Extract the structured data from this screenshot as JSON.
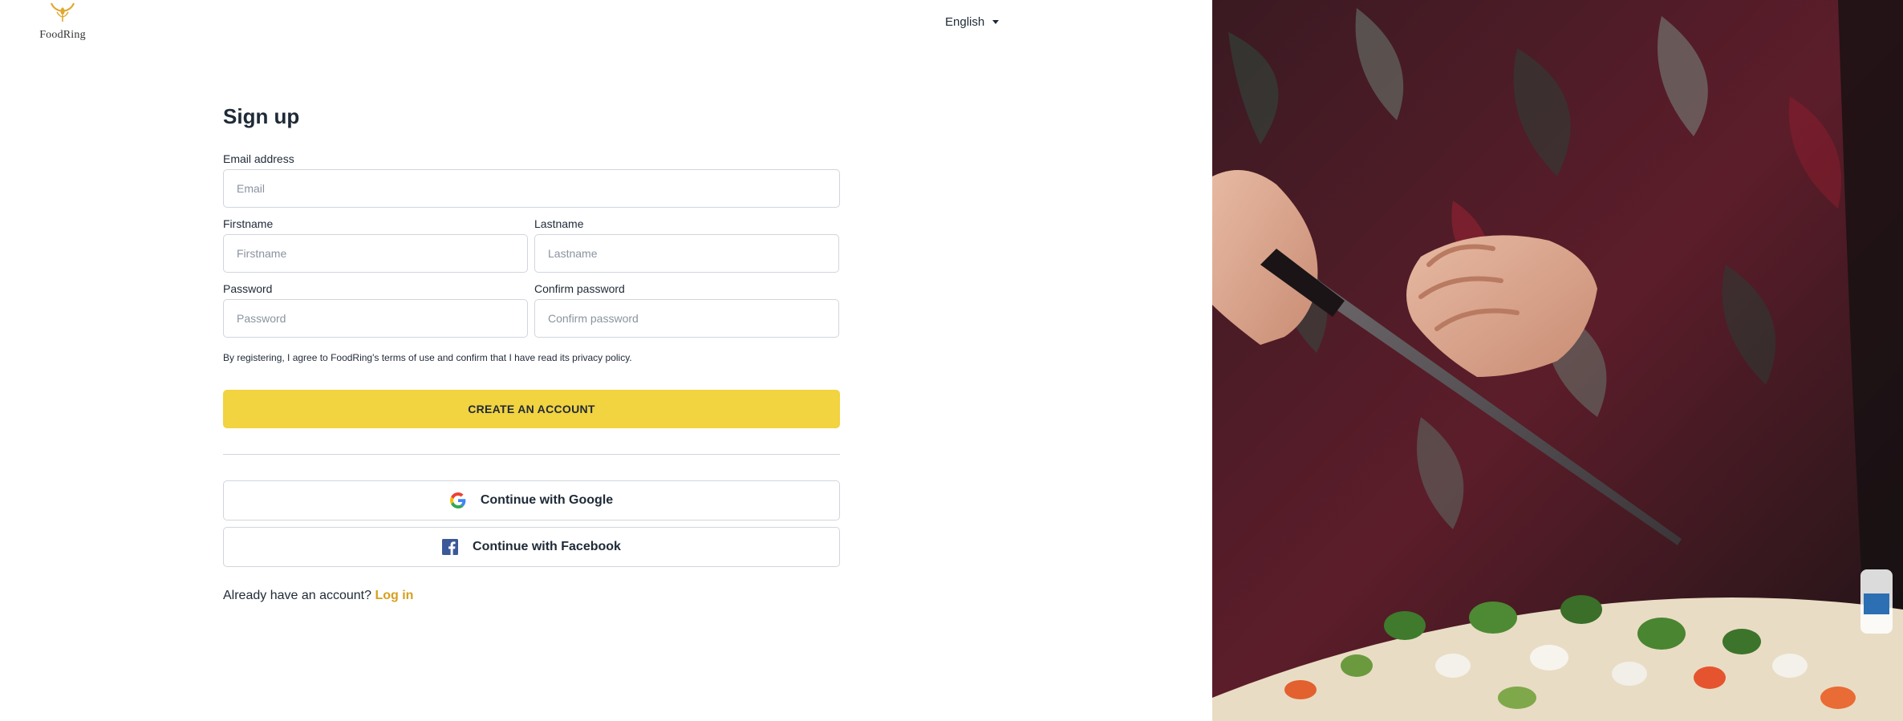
{
  "brand": {
    "name": "FoodRing"
  },
  "header": {
    "language": "English"
  },
  "form": {
    "title": "Sign up",
    "email": {
      "label": "Email address",
      "placeholder": "Email"
    },
    "firstname": {
      "label": "Firstname",
      "placeholder": "Firstname"
    },
    "lastname": {
      "label": "Lastname",
      "placeholder": "Lastname"
    },
    "password": {
      "label": "Password",
      "placeholder": "Password"
    },
    "confirm": {
      "label": "Confirm password",
      "placeholder": "Confirm password"
    },
    "terms": "By registering, I agree to FoodRing's terms of use and confirm that I have read its privacy policy.",
    "submit_label": "CREATE AN ACCOUNT"
  },
  "social": {
    "google_label": "Continue with Google",
    "facebook_label": "Continue with Facebook"
  },
  "footer": {
    "prompt": "Already have an account?",
    "login_label": "Log in"
  },
  "colors": {
    "accent": "#f2d340",
    "link": "#d6a020",
    "facebook": "#3b5998"
  },
  "icons": [
    "foodring-logo-icon",
    "caret-down-icon",
    "google-icon",
    "facebook-icon"
  ]
}
